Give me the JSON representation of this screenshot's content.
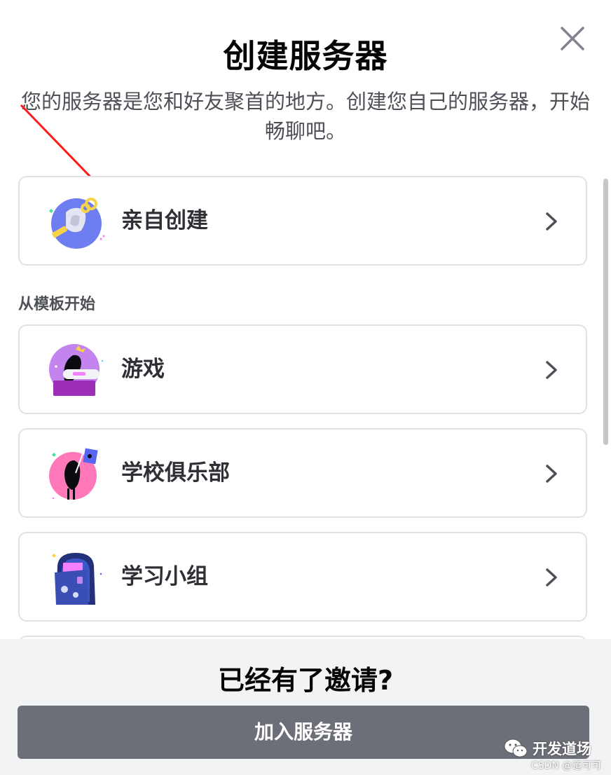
{
  "dialog": {
    "title": "创建服务器",
    "subtitle": "您的服务器是您和好友聚首的地方。创建您自己的服务器，开始畅聊吧。",
    "close_icon": "close-icon"
  },
  "options": {
    "create_own": {
      "label": "亲自创建",
      "icon": "create-server-illustration"
    },
    "template_section_label": "从模板开始",
    "templates": [
      {
        "label": "游戏",
        "icon": "gaming-illustration"
      },
      {
        "label": "学校俱乐部",
        "icon": "school-club-illustration"
      },
      {
        "label": "学习小组",
        "icon": "study-group-illustration"
      }
    ]
  },
  "footer": {
    "title": "已经有了邀请?",
    "join_button": "加入服务器"
  },
  "watermark": {
    "channel": "开发道场",
    "source": "CSDN @道可可"
  },
  "colors": {
    "annotation_arrow": "#ff1a1a",
    "join_button_bg": "#6d6f78",
    "footer_bg": "#f2f3f5",
    "border": "#e1e2e5"
  }
}
